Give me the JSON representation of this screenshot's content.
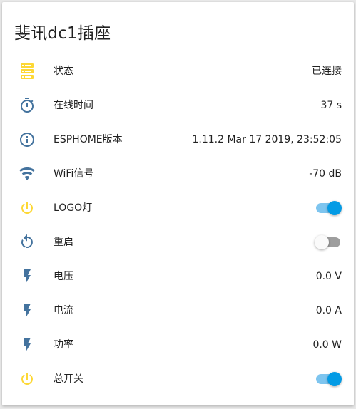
{
  "card": {
    "title": "斐讯dc1插座"
  },
  "colors": {
    "icon_blue": "#44739e",
    "icon_yellow": "#fdd835",
    "toggle_on": "#039be5"
  },
  "rows": [
    {
      "icon": "server-icon",
      "label": "状态",
      "value": "已连接"
    },
    {
      "icon": "timer-icon",
      "label": "在线时间",
      "value": "37 s"
    },
    {
      "icon": "info-icon",
      "label": "ESPHOME版本",
      "value": "1.11.2 Mar 17 2019, 23:52:05"
    },
    {
      "icon": "wifi-icon",
      "label": "WiFi信号",
      "value": "-70 dB"
    },
    {
      "icon": "power-icon",
      "label": "LOGO灯",
      "state": "on"
    },
    {
      "icon": "restart-icon",
      "label": "重启",
      "state": "off"
    },
    {
      "icon": "flash-icon",
      "label": "电压",
      "value": "0.0 V"
    },
    {
      "icon": "flash-icon",
      "label": "电流",
      "value": "0.0 A"
    },
    {
      "icon": "flash-icon",
      "label": "功率",
      "value": "0.0 W"
    },
    {
      "icon": "power-icon",
      "label": "总开关",
      "state": "on"
    }
  ]
}
